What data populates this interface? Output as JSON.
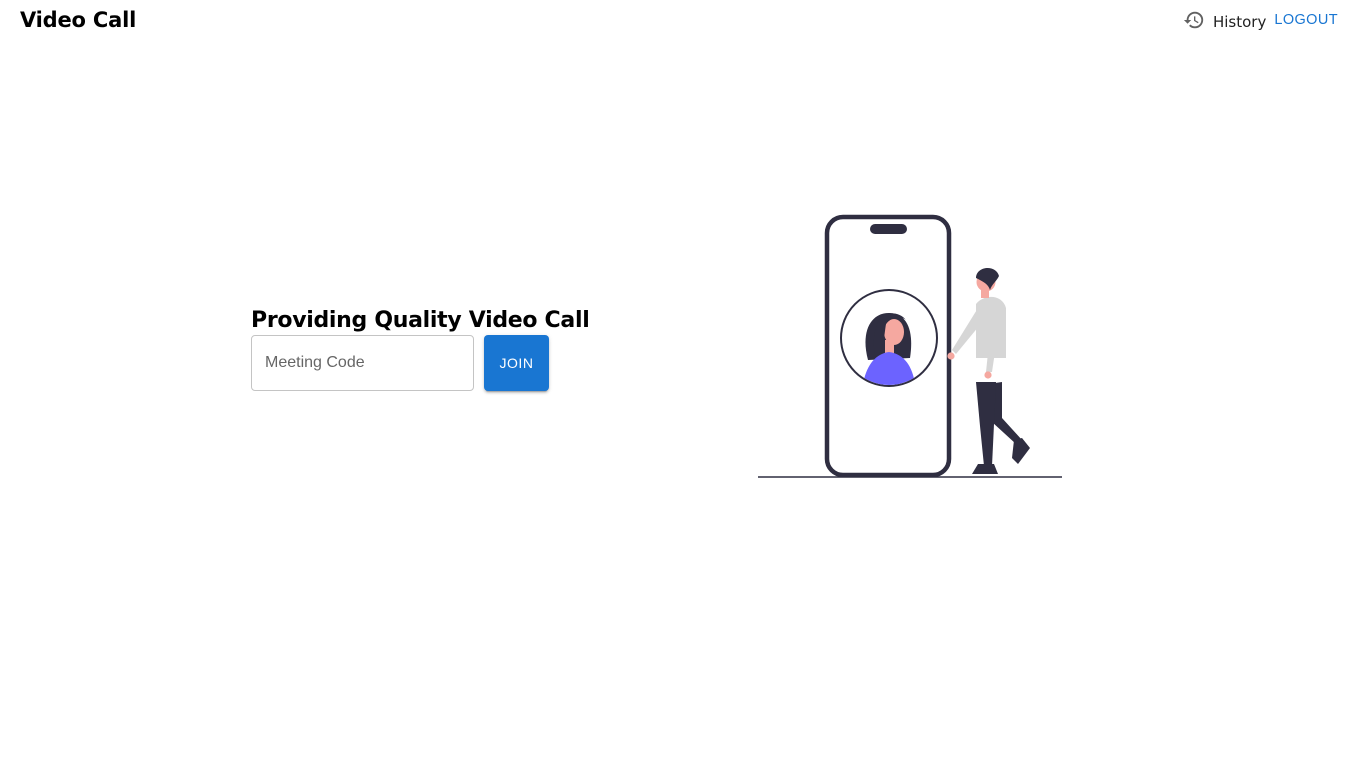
{
  "header": {
    "app_title": "Video Call",
    "history_icon": "history-icon",
    "history_label": "History",
    "logout_label": "LOGOUT",
    "accent_color": "#1976d2"
  },
  "main": {
    "title": "Providing Quality Video Call",
    "meeting_code_placeholder": "Meeting Code",
    "meeting_code_value": "",
    "join_label": "JOIN"
  },
  "illustration": {
    "icon": "video-call-illustration",
    "colors": {
      "outline": "#2f2e41",
      "accent": "#6c63ff",
      "skin": "#f5a8a0",
      "shirt": "#d6d6d6"
    }
  }
}
